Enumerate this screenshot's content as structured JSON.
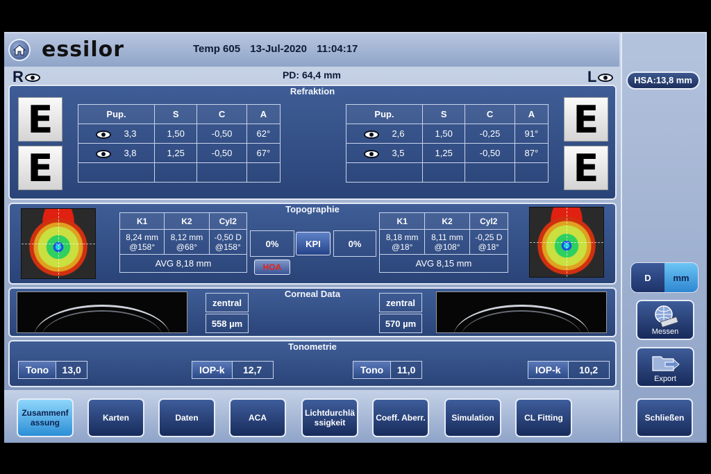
{
  "header": {
    "brand": "essilor",
    "temp": "Temp 605",
    "date": "13-Jul-2020",
    "time": "11:04:17"
  },
  "pd": "PD: 64,4 mm",
  "eye_right_label": "R",
  "eye_left_label": "L",
  "hsa": "HSA:13,8 mm",
  "refraktion": {
    "title": "Refraktion",
    "columns": [
      "Pup.",
      "S",
      "C",
      "A"
    ],
    "right_rows": [
      [
        "3,3",
        "1,50",
        "-0,50",
        "62°"
      ],
      [
        "3,8",
        "1,25",
        "-0,50",
        "67°"
      ]
    ],
    "left_rows": [
      [
        "2,6",
        "1,50",
        "-0,25",
        "91°"
      ],
      [
        "3,5",
        "1,25",
        "-0,50",
        "87°"
      ]
    ],
    "chart_letter": "E"
  },
  "topographie": {
    "title": "Topographie",
    "columns": [
      "K1",
      "K2",
      "Cyl2"
    ],
    "right_values": [
      "8,24 mm\n@158°",
      "8,12 mm\n@68°",
      "-0,50 D\n@158°"
    ],
    "left_values": [
      "8,18 mm\n@18°",
      "8,11 mm\n@108°",
      "-0,25 D\n@18°"
    ],
    "right_avg": "AVG 8,18 mm",
    "left_avg": "AVG 8,15 mm",
    "right_pct": "0%",
    "left_pct": "0%",
    "kpi": "KPI",
    "hoa": "HOA"
  },
  "corneal": {
    "title": "Corneal Data",
    "label": "zentral",
    "right_value": "558 µm",
    "left_value": "570 µm"
  },
  "tonometrie": {
    "title": "Tonometrie",
    "items": [
      {
        "key": "Tono",
        "value": "13,0"
      },
      {
        "key": "IOP-k",
        "value": "12,7"
      },
      {
        "key": "Tono",
        "value": "11,0"
      },
      {
        "key": "IOP-k",
        "value": "10,2"
      }
    ]
  },
  "units": {
    "d": "D",
    "mm": "mm"
  },
  "side_buttons": {
    "measure": "Messen",
    "export": "Export"
  },
  "footer": {
    "tabs": [
      "Zusammenf assung",
      "Karten",
      "Daten",
      "ACA",
      "Lichtdurchlä ssigkeit",
      "Coeff. Aberr.",
      "Simulation",
      "CL Fitting"
    ],
    "close": "Schließen"
  }
}
